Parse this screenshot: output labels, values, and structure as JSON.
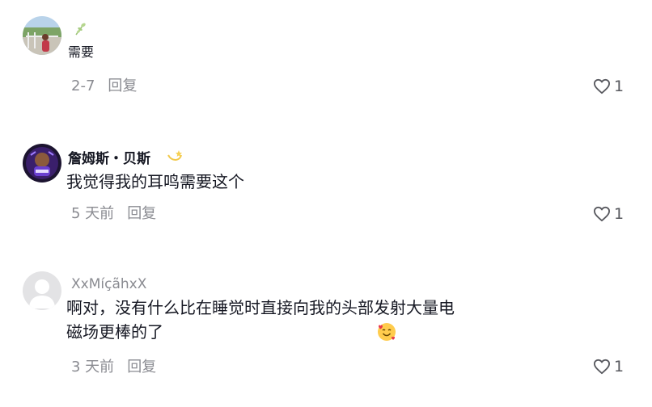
{
  "comments": [
    {
      "username": "",
      "text": "需要",
      "date": "2-7",
      "reply_label": "回复",
      "likes": "1",
      "avatar": "landscape-photo-avatar",
      "badge_icon": "leaf-sprig-icon"
    },
    {
      "username": "詹姆斯・贝斯",
      "text": "我觉得我的耳鸣需要这个",
      "date": "5 天前",
      "reply_label": "回复",
      "likes": "1",
      "avatar": "purple-logo-avatar",
      "badge_icon": "dizzy-star-icon"
    },
    {
      "username": "XxMíçãhxX",
      "text_line1": "啊对，没有什么比在睡觉时直接向我的头部发射大量电",
      "text_line2": "磁场更棒的了",
      "date": "3 天前",
      "reply_label": "回复",
      "likes": "1",
      "avatar": "default-gray-avatar",
      "emoji_icon": "smiling-face-with-hearts-icon"
    }
  ],
  "colors": {
    "text": "#161823",
    "secondary": "#8a8b91",
    "icon": "#57585e"
  }
}
